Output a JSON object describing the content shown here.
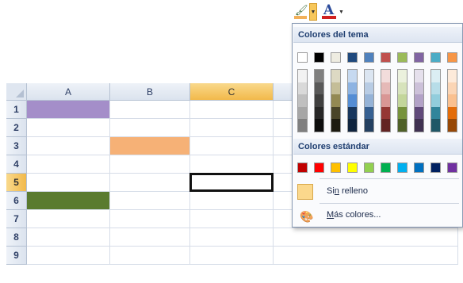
{
  "toolbar": {
    "fill_icon": "paint-bucket-icon",
    "fill_color": "#f2b05a",
    "font_icon": "font-color-icon",
    "font_letter": "A",
    "font_color": "#d02020",
    "arrow_glyph": "▼"
  },
  "sheet": {
    "columns": [
      "A",
      "B",
      "C"
    ],
    "rows": [
      "1",
      "2",
      "3",
      "4",
      "5",
      "6",
      "7",
      "8",
      "9"
    ],
    "selected_column": "C",
    "selected_row": "5",
    "filled_cells": [
      {
        "col": "A",
        "row": "1",
        "color": "#a48ec9"
      },
      {
        "col": "B",
        "row": "3",
        "color": "#f6b176"
      },
      {
        "col": "A",
        "row": "6",
        "color": "#5a7b2f"
      }
    ]
  },
  "menu": {
    "theme_title": "Colores del tema",
    "standard_title": "Colores estándar",
    "theme_top": [
      "#ffffff",
      "#000000",
      "#eeece1",
      "#1f497d",
      "#4f81bd",
      "#c0504d",
      "#9bbb59",
      "#8064a2",
      "#4bacc6",
      "#f79646"
    ],
    "theme_shades": [
      [
        "#f2f2f2",
        "#d9d9d9",
        "#bfbfbf",
        "#a6a6a6",
        "#7f7f7f"
      ],
      [
        "#7f7f7f",
        "#595959",
        "#3f3f3f",
        "#262626",
        "#0d0d0d"
      ],
      [
        "#ddd9c3",
        "#c4bd97",
        "#938953",
        "#494429",
        "#1d1b10"
      ],
      [
        "#c6d9f0",
        "#8db3e2",
        "#548dd4",
        "#17365d",
        "#0f243e"
      ],
      [
        "#dbe5f1",
        "#b8cce4",
        "#95b3d7",
        "#366092",
        "#244061"
      ],
      [
        "#f2dcdb",
        "#e5b9b7",
        "#d99694",
        "#953734",
        "#632423"
      ],
      [
        "#ebf1dd",
        "#d7e3bc",
        "#c3d69b",
        "#76923c",
        "#4f6128"
      ],
      [
        "#e5e0ec",
        "#ccc1d9",
        "#b2a2c7",
        "#5f497a",
        "#3f3151"
      ],
      [
        "#dbeef3",
        "#b7dde8",
        "#92cddc",
        "#31859b",
        "#205867"
      ],
      [
        "#fdeada",
        "#fbd5b5",
        "#fac08f",
        "#e36c09",
        "#974806"
      ]
    ],
    "standard": [
      "#c00000",
      "#ff0000",
      "#ffc000",
      "#ffff00",
      "#92d050",
      "#00b050",
      "#00b0f0",
      "#0070c0",
      "#002060",
      "#7030a0"
    ],
    "no_fill_pre": "Si",
    "no_fill_u": "n",
    "no_fill_post": " relleno",
    "more_u": "M",
    "more_post": "ás colores...",
    "no_fill_icon": "no-fill-swatch-icon",
    "more_icon": "palette-icon"
  }
}
